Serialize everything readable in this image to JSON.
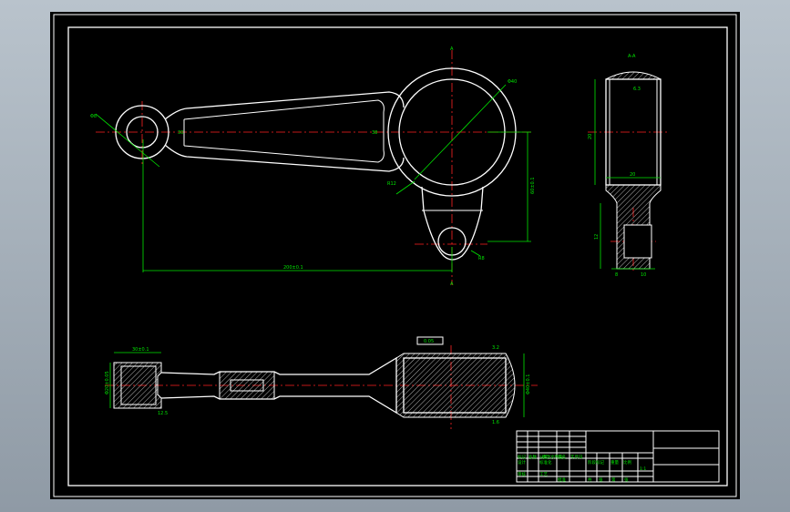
{
  "colors": {
    "background": "#000000",
    "outline": "#ffffff",
    "dimension": "#00e600",
    "centerline": "#ff2222",
    "frame_bg": "#a3adb7"
  },
  "section_labels": {
    "top": "A",
    "bottom": "A",
    "side_view": "A-A"
  },
  "dimensions": {
    "overall_length": "200±0.1",
    "vertical_offset": "60±0.1",
    "small_bore": "Φ8",
    "big_bore": "Φ40",
    "radius_big": "R12",
    "radius_small": "R8",
    "shank_w": "30",
    "big_w": "38",
    "side_w": "20",
    "side_h1": "12",
    "bottom_w1": "8",
    "bottom_w2": "10",
    "side_h2": "20",
    "flatness": "0.05",
    "left_dim1": "Φ20±0.05",
    "left_dim2": "30±0.1",
    "right_dim": "Φ40±0.1",
    "ra1": "6.3",
    "ra2": "3.2",
    "ra3": "1.6",
    "ra4": "12.5"
  },
  "title_block": {
    "cells": [
      "标记",
      "处数",
      "分区",
      "更改文件号",
      "签名",
      "年月日",
      "设计",
      "标准化",
      "阶段标记",
      "重量",
      "比例",
      "1:1",
      "审核",
      "工艺",
      "批准",
      "共",
      "张",
      "第",
      "张"
    ]
  }
}
